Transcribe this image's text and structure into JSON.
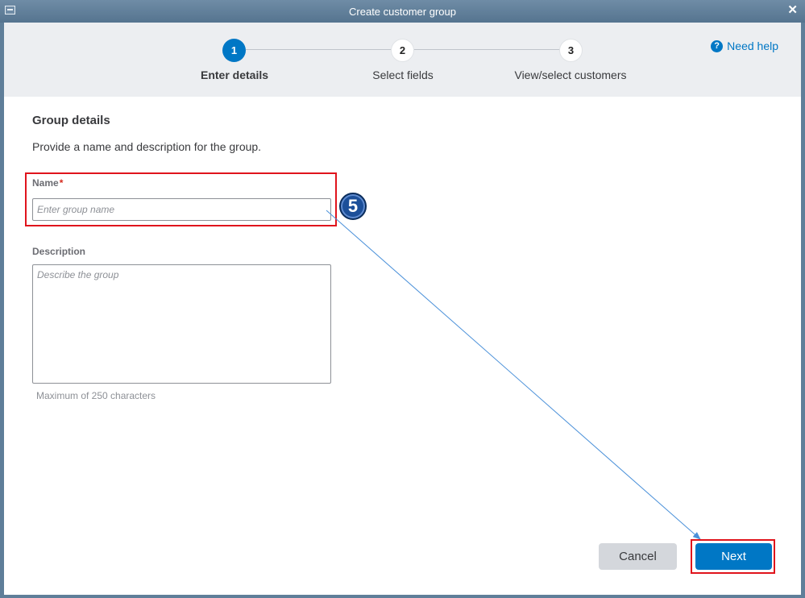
{
  "window": {
    "title": "Create customer group"
  },
  "stepper": {
    "steps": [
      {
        "number": "1",
        "label": "Enter details",
        "state": "active"
      },
      {
        "number": "2",
        "label": "Select fields",
        "state": "inactive"
      },
      {
        "number": "3",
        "label": "View/select customers",
        "state": "inactive"
      }
    ],
    "help_label": "Need help"
  },
  "form": {
    "heading": "Group details",
    "description": "Provide a name and description for the group.",
    "name": {
      "label": "Name",
      "required_mark": "*",
      "placeholder": "Enter group name",
      "value": ""
    },
    "description_field": {
      "label": "Description",
      "placeholder": "Describe the group",
      "value": "",
      "hint": "Maximum of 250 characters"
    }
  },
  "annotation": {
    "step_number": "5"
  },
  "buttons": {
    "cancel": "Cancel",
    "next": "Next"
  },
  "colors": {
    "accent": "#0077c5",
    "highlight": "#e0141c",
    "titlebar": "#5f7e99"
  }
}
